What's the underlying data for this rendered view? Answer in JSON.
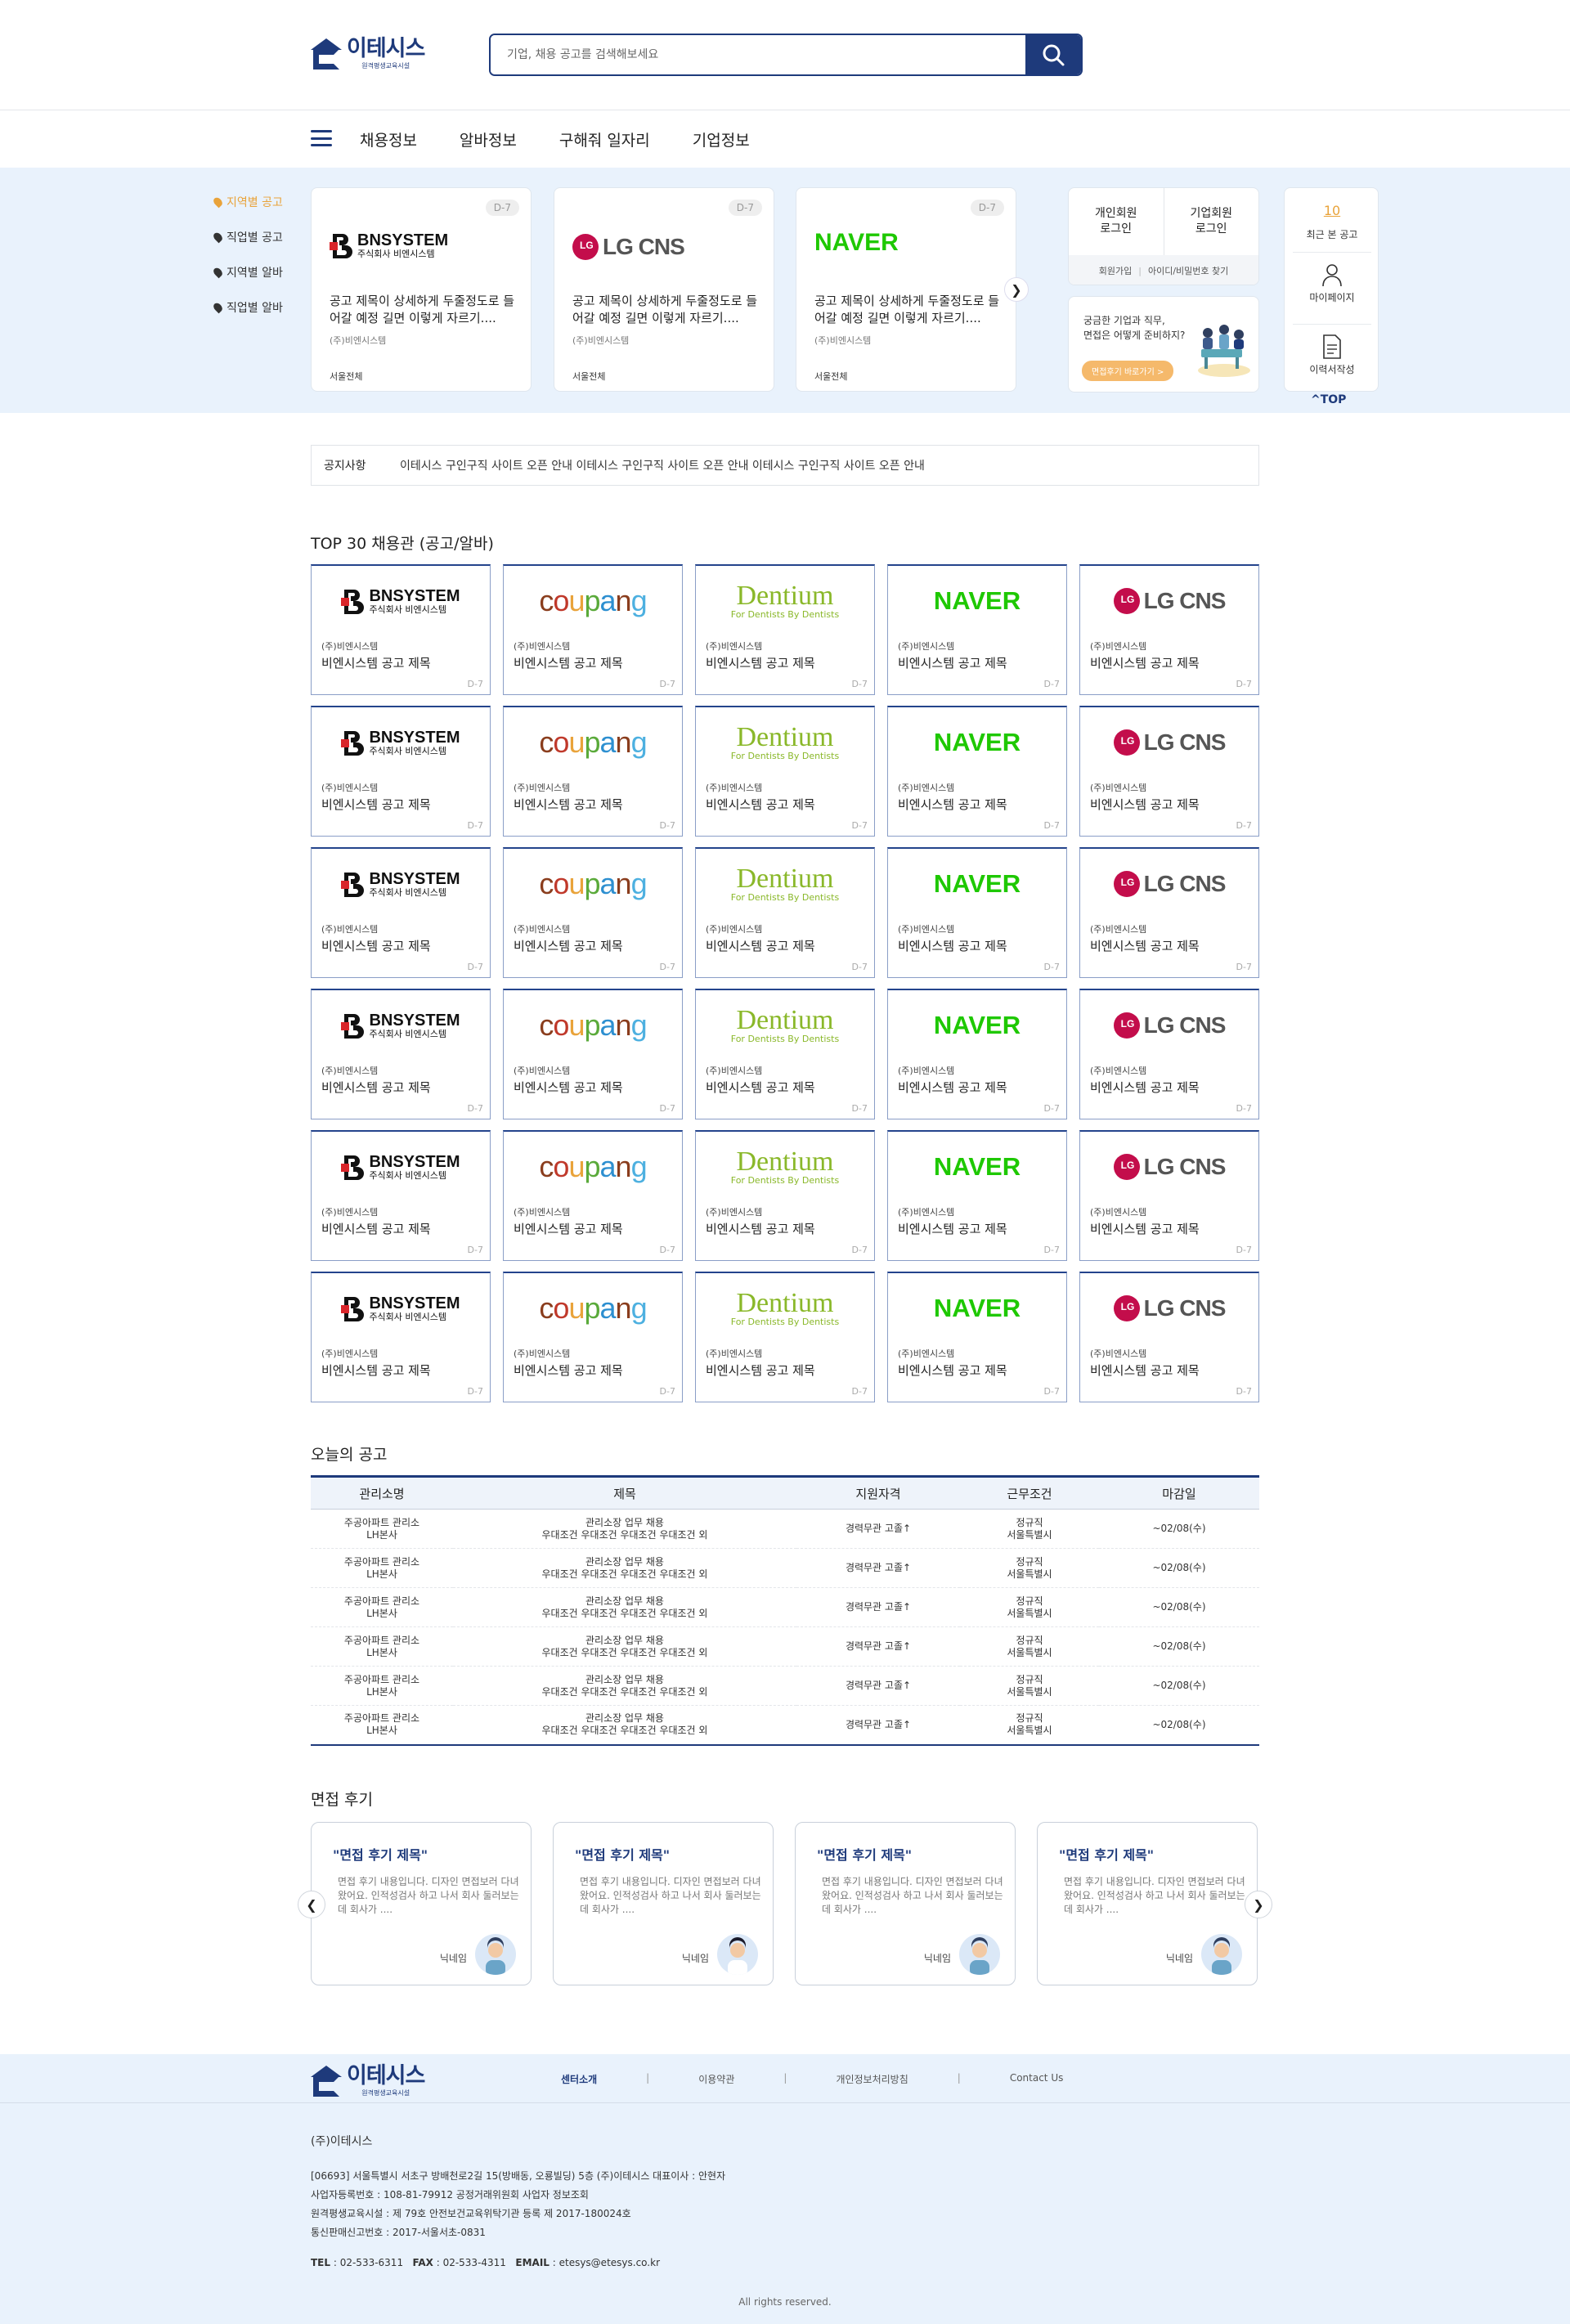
{
  "header": {
    "logo_name": "이테시스",
    "logo_sub": "원격평생교육시설",
    "search_placeholder": "기업, 채용 공고를 검색해보세요"
  },
  "nav": {
    "items": [
      "채용정보",
      "알바정보",
      "구해줘 일자리",
      "기업정보"
    ]
  },
  "side_menu": {
    "items": [
      "지역별 공고",
      "직업별 공고",
      "지역별 알바",
      "직업별 알바"
    ]
  },
  "hero_cards": [
    {
      "dday": "D-7",
      "brand": "BNSYSTEM",
      "brand_sub": "주식회사 비엔시스템",
      "title": "공고 제목이 상세하게 두줄정도로 들어갈 예정 길면 이렇게 자르기....",
      "company": "(주)비엔시스템",
      "location": "서울전체"
    },
    {
      "dday": "D-7",
      "brand": "LG CNS",
      "title": "공고 제목이 상세하게 두줄정도로 들어갈 예정 길면 이렇게 자르기....",
      "company": "(주)비엔시스템",
      "location": "서울전체"
    },
    {
      "dday": "D-7",
      "brand": "NAVER",
      "title": "공고 제목이 상세하게 두줄정도로 들어갈 예정 길면 이렇게 자르기....",
      "company": "(주)비엔시스템",
      "location": "서울전체"
    }
  ],
  "login": {
    "personal": "개인회원\n로그인",
    "company": "기업회원\n로그인",
    "signup": "회원가입",
    "find": "아이디/비밀번호 찾기"
  },
  "promo": {
    "text": "궁금한 기업과 직무,\n면접은 어떻게 준비하지?",
    "button": "면접후기 바로가기 >"
  },
  "quick": {
    "recent_count": "10",
    "recent_label": "최근 본 공고",
    "mypage": "마이페이지",
    "resume": "이력서작성",
    "top": "TOP"
  },
  "notice": {
    "label": "공지사항",
    "text": "이테시스 구인구직 사이트 오픈 안내 이테시스 구인구직 사이트 오픈 안내 이테시스 구인구직 사이트 오픈 안내"
  },
  "top30": {
    "title": "TOP 30 채용관 (공고/알바)",
    "card_company": "(주)비엔시스템",
    "card_title": "비엔시스템 공고 제목",
    "card_dday": "D-7",
    "brands": [
      "BNSYSTEM",
      "coupang",
      "Dentium",
      "NAVER",
      "LG CNS"
    ],
    "bn_sub": "주식회사 비엔시스템",
    "dentium_sub": "For Dentists By Dentists",
    "rows": 6
  },
  "today": {
    "title": "오늘의 공고",
    "headers": [
      "관리소명",
      "제목",
      "지원자격",
      "근무조건",
      "마감일"
    ],
    "rows": [
      {
        "org1": "주공아파트 관리소",
        "org2": "LH본사",
        "t1": "관리소장 업무 채용",
        "t2": "우대조건 우대조건 우대조건 우대조건 외",
        "qual": "경력무관 고졸↑",
        "c1": "정규직",
        "c2": "서울특별시",
        "due": "~02/08(수)"
      },
      {
        "org1": "주공아파트 관리소",
        "org2": "LH본사",
        "t1": "관리소장 업무 채용",
        "t2": "우대조건 우대조건 우대조건 우대조건 외",
        "qual": "경력무관 고졸↑",
        "c1": "정규직",
        "c2": "서울특별시",
        "due": "~02/08(수)"
      },
      {
        "org1": "주공아파트 관리소",
        "org2": "LH본사",
        "t1": "관리소장 업무 채용",
        "t2": "우대조건 우대조건 우대조건 우대조건 외",
        "qual": "경력무관 고졸↑",
        "c1": "정규직",
        "c2": "서울특별시",
        "due": "~02/08(수)"
      },
      {
        "org1": "주공아파트 관리소",
        "org2": "LH본사",
        "t1": "관리소장 업무 채용",
        "t2": "우대조건 우대조건 우대조건 우대조건 외",
        "qual": "경력무관 고졸↑",
        "c1": "정규직",
        "c2": "서울특별시",
        "due": "~02/08(수)"
      },
      {
        "org1": "주공아파트 관리소",
        "org2": "LH본사",
        "t1": "관리소장 업무 채용",
        "t2": "우대조건 우대조건 우대조건 우대조건 외",
        "qual": "경력무관 고졸↑",
        "c1": "정규직",
        "c2": "서울특별시",
        "due": "~02/08(수)"
      },
      {
        "org1": "주공아파트 관리소",
        "org2": "LH본사",
        "t1": "관리소장 업무 채용",
        "t2": "우대조건 우대조건 우대조건 우대조건 외",
        "qual": "경력무관 고졸↑",
        "c1": "정규직",
        "c2": "서울특별시",
        "due": "~02/08(수)"
      }
    ]
  },
  "reviews": {
    "title": "면접 후기",
    "items": [
      {
        "title": "\"면접 후기 제목\"",
        "body": "면접 후기 내용입니다. 디자인 면접보러 다녀왔어요. 인적성검사 하고 나서 회사 둘러보는데 회사가 ....",
        "nick": "닉네임"
      },
      {
        "title": "\"면접 후기 제목\"",
        "body": "면접 후기 내용입니다. 디자인 면접보러 다녀왔어요. 인적성검사 하고 나서 회사 둘러보는데 회사가 ....",
        "nick": "닉네임"
      },
      {
        "title": "\"면접 후기 제목\"",
        "body": "면접 후기 내용입니다. 디자인 면접보러 다녀왔어요. 인적성검사 하고 나서 회사 둘러보는데 회사가 ....",
        "nick": "닉네임"
      },
      {
        "title": "\"면접 후기 제목\"",
        "body": "면접 후기 내용입니다. 디자인 면접보러 다녀왔어요. 인적성검사 하고 나서 회사 둘러보는데 회사가 ....",
        "nick": "닉네임"
      }
    ]
  },
  "footer": {
    "links": [
      "센터소개",
      "이용약관",
      "개인정보처리방침",
      "Contact Us"
    ],
    "company": "(주)이테시스",
    "address": "[06693] 서울특별시 서초구 방배천로2길 15(방배동, 오룡빌딩) 5층 (주)이테시스 대표이사 : 안현자",
    "biz": "사업자등록번호 : 108-81-79912 공정거래위원회 사업자 정보조회",
    "facility": "원격평생교육시설 : 제 79호 안전보건교육위탁기관 등록 제 2017-180024호",
    "mail_order": "통신판매신고번호 : 2017-서울서초-0831",
    "tel_label": "TEL",
    "tel": "02-533-6311",
    "fax_label": "FAX",
    "fax": "02-533-4311",
    "email_label": "EMAIL",
    "email": "etesys@etesys.co.kr",
    "copyright": "All rights reserved."
  },
  "colors": {
    "primary": "#1e3a7b",
    "accent": "#e9a33a",
    "hero_bg": "#e9f2fc",
    "naver": "#1ec800",
    "lg": "#c30d4b",
    "dentium": "#8ab82a"
  }
}
